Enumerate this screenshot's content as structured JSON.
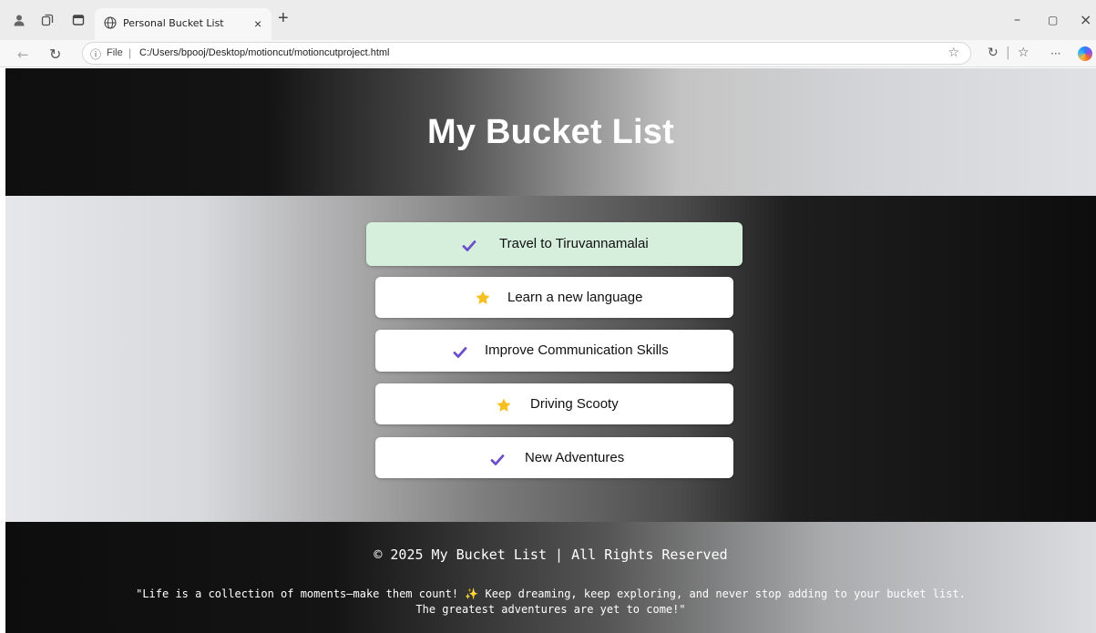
{
  "browser": {
    "tab_title": "Personal Bucket List",
    "tab_close": "×",
    "new_tab": "+",
    "address_scheme": "File",
    "address_separator": "|",
    "address_url": "C:/Users/bpooj/Desktop/motioncut/motioncutproject.html",
    "window_controls": {
      "minimize": "–",
      "restore": "▢",
      "close": "×"
    },
    "toolbar": {
      "more": "···",
      "divider": "|"
    }
  },
  "page": {
    "title": "My Bucket List",
    "items": [
      {
        "label": "Travel to Tiruvannamalai",
        "icon": "check-icon",
        "highlighted": true
      },
      {
        "label": "Learn a new language",
        "icon": "star-icon",
        "highlighted": false
      },
      {
        "label": "Improve Communication Skills",
        "icon": "check-icon",
        "highlighted": false
      },
      {
        "label": "Driving Scooty",
        "icon": "star-icon",
        "highlighted": false
      },
      {
        "label": "New Adventures",
        "icon": "check-icon",
        "highlighted": false
      }
    ],
    "footer": {
      "copyright": "© 2025 My Bucket List | All Rights Reserved",
      "quote_line1_before": "\"Life is a collection of moments—make them count! ",
      "quote_sparkle": "✨",
      "quote_line1_after": " Keep dreaming, keep exploring, and never stop adding to your bucket list.",
      "quote_line2": "The greatest adventures are yet to come!\""
    }
  },
  "colors": {
    "highlight_item_bg": "#d6efdc",
    "check": "#6a4fc9",
    "star": "#f5c020"
  }
}
